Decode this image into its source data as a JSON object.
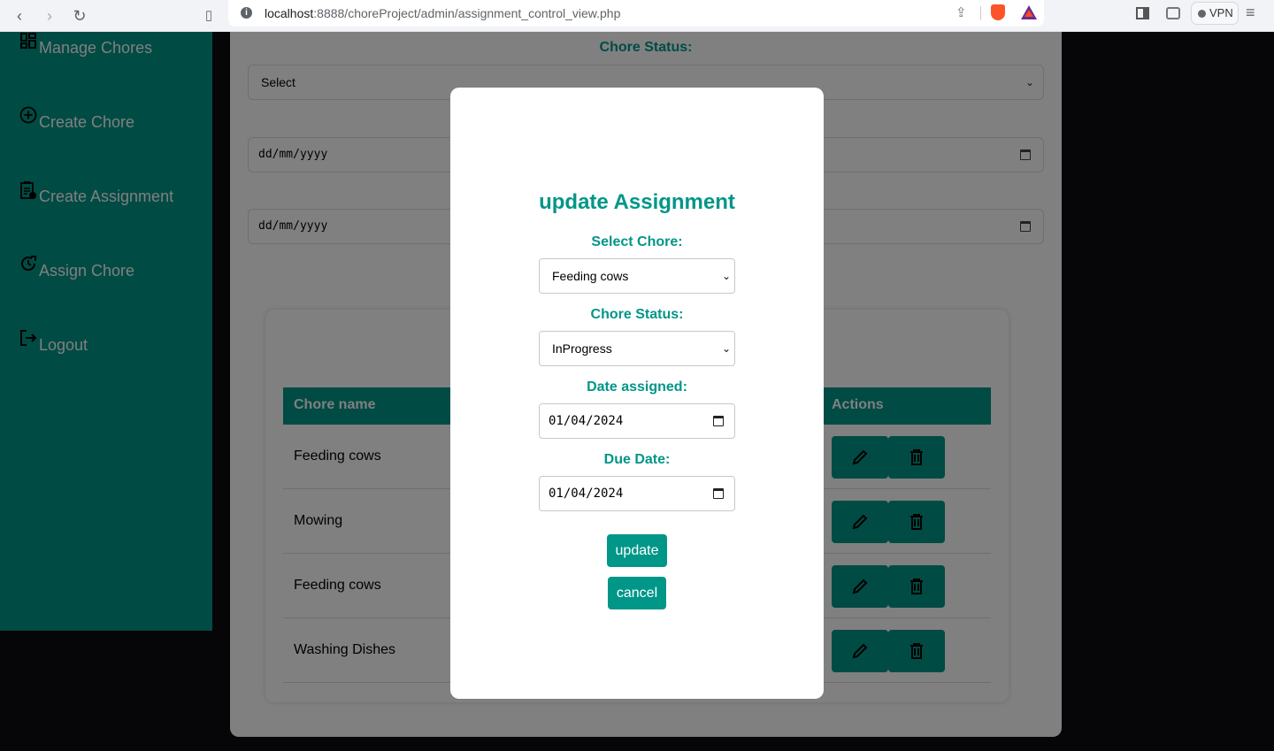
{
  "browser": {
    "url_host": "localhost",
    "url_rest": ":8888/choreProject/admin/assignment_control_view.php",
    "vpn_label": "VPN"
  },
  "sidebar": {
    "items": [
      {
        "label": "Manage Chores",
        "icon": "dashboard-icon"
      },
      {
        "label": "Create Chore",
        "icon": "plus-circle-icon"
      },
      {
        "label": "Create Assignment",
        "icon": "clipboard-add-icon"
      },
      {
        "label": "Assign Chore",
        "icon": "clock-refresh-icon"
      },
      {
        "label": "Logout",
        "icon": "logout-icon"
      }
    ]
  },
  "filters": {
    "status_label": "Chore Status:",
    "status_value": "Select",
    "date_from_placeholder": "dd/mm/yyyy",
    "date_to_placeholder": "dd/mm/yyyy"
  },
  "table": {
    "headers": {
      "name": "Chore name",
      "actions": "Actions"
    },
    "rows": [
      {
        "name": "Feeding cows"
      },
      {
        "name": "Mowing"
      },
      {
        "name": "Feeding cows"
      },
      {
        "name": "Washing Dishes"
      }
    ]
  },
  "modal": {
    "title": "update Assignment",
    "select_chore_label": "Select Chore:",
    "select_chore_value": "Feeding cows",
    "status_label": "Chore Status:",
    "status_value": "InProgress",
    "date_assigned_label": "Date assigned:",
    "date_assigned_value": "01/04/2024",
    "due_date_label": "Due Date:",
    "due_date_value": "01/04/2024",
    "update_label": "update",
    "cancel_label": "cancel"
  },
  "colors": {
    "accent": "#009688",
    "accent_dimmed": "#004b44",
    "overlay_gray": "#808080"
  }
}
